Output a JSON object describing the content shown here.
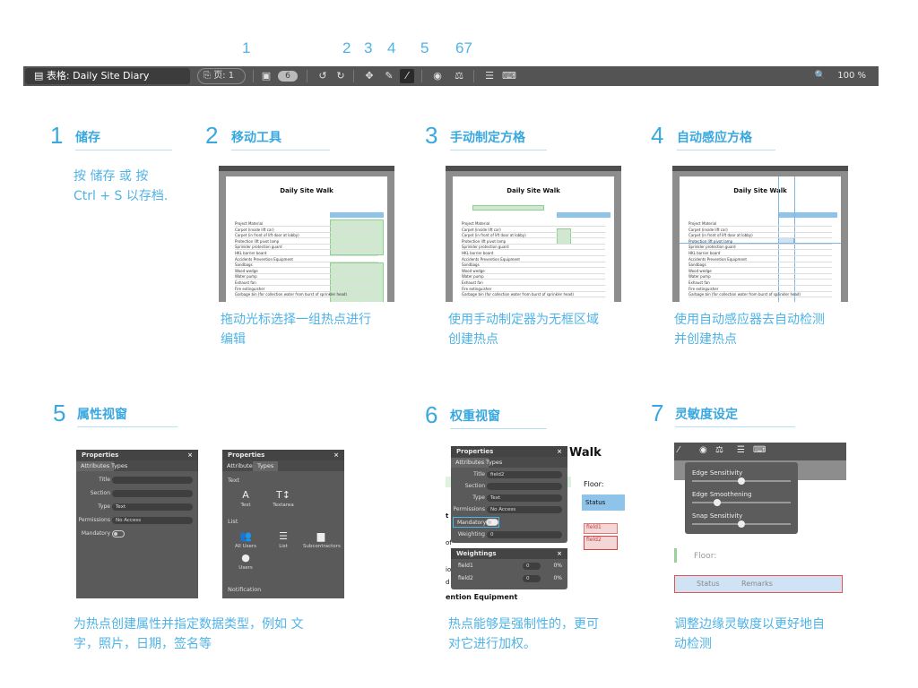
{
  "markers": [
    "1",
    "2",
    "3",
    "4",
    "5",
    "67"
  ],
  "toolbar": {
    "doc_icon": "document-icon",
    "title": "表格: Daily Site Diary",
    "page_label": "页: 1",
    "badge": "6",
    "zoom": "100 %"
  },
  "sections": [
    {
      "num": "1",
      "title": "储存",
      "desc_lines": [
        "按 储存 或 按",
        "Ctrl + S 以存档."
      ]
    },
    {
      "num": "2",
      "title": "移动工具",
      "desc_lines": [
        "拖动光标选择一组热点进行",
        "编辑"
      ]
    },
    {
      "num": "3",
      "title": "手动制定方格",
      "desc_lines": [
        "使用手动制定器为无框区域",
        "创建热点"
      ]
    },
    {
      "num": "4",
      "title": "自动感应方格",
      "desc_lines": [
        "使用自动感应器去自动检测",
        "并创建热点"
      ]
    },
    {
      "num": "5",
      "title": "属性视窗",
      "desc_lines": [
        "为热点创建属性并指定数据类型，例如 文",
        "字，照片，日期，签名等"
      ]
    },
    {
      "num": "6",
      "title": "权重视窗",
      "desc_lines": [
        "热点能够是强制性的，更可",
        "对它进行加权。"
      ]
    },
    {
      "num": "7",
      "title": "灵敏度设定",
      "desc_lines": [
        "调整边缘灵敏度以更好地自",
        "动检测"
      ]
    }
  ],
  "thumb_doc": {
    "title": "Daily Site Walk",
    "date_label": "Date:",
    "floor_label": "Floor:",
    "status": "Status",
    "remarks": "Remarks",
    "rows": [
      "Project Material",
      "Carpet (inside lift car)",
      "Carpet (in front of lift door at lobby)",
      "Protection lift pivot lamp",
      "Sprinkler protection guard",
      "HKL barrier board",
      "Accidents Prevention Equipment",
      "Sandbags",
      "Wood wedge",
      "Water pump",
      "Exhaust fan",
      "Fire extinguisher",
      "Garbage bin (for collection water from burst of sprinkler head)"
    ]
  },
  "props_attr": {
    "header": "Properties",
    "tab1": "Attributes",
    "tab2": "Types",
    "fields": [
      {
        "label": "Title",
        "value": ""
      },
      {
        "label": "Section",
        "value": ""
      },
      {
        "label": "Type",
        "value": "Text"
      },
      {
        "label": "Permissions",
        "value": "No Access"
      }
    ],
    "mandatory_label": "Mandatory"
  },
  "props_types": {
    "header": "Properties",
    "tab1": "Attributes",
    "tab2": "Types",
    "text_section": "Text",
    "text_items": [
      "Text",
      "Textarea"
    ],
    "list_section": "List",
    "list_items": [
      "All Users",
      "List",
      "Subcontractors"
    ],
    "users_item": "Users",
    "notification": "Notification"
  },
  "weights_thumb": {
    "header": "Properties",
    "tab1": "Attributes",
    "tab2": "Types",
    "title_val": "field2",
    "type_val": "Text",
    "perm_val": "No Access",
    "mandatory": "Mandatory",
    "weighting": "Weighting",
    "weighting_val": "0",
    "weights_header": "Weightings",
    "weights": [
      {
        "name": "field1",
        "val": "0",
        "pct": "0%"
      },
      {
        "name": "field2",
        "val": "0",
        "pct": "0%"
      }
    ],
    "bg_walk": "Walk",
    "bg_floor": "Floor:",
    "bg_status": "Status",
    "bg_field1": "field1",
    "bg_field2": "field2",
    "bg_equip": "ention Equipment",
    "bg_letters": [
      "t",
      "of",
      "io",
      "d"
    ]
  },
  "sensitivity_thumb": {
    "edge_sensitivity": "Edge Sensitivity",
    "edge_smoothening": "Edge Smoothening",
    "snap_sensitivity": "Snap Sensitivity",
    "edge_sensitivity_level": 0.5,
    "edge_smoothening_level": 0.25,
    "snap_sensitivity_level": 0.5,
    "floor": "Floor:",
    "status": "Status",
    "remarks": "Remarks"
  }
}
